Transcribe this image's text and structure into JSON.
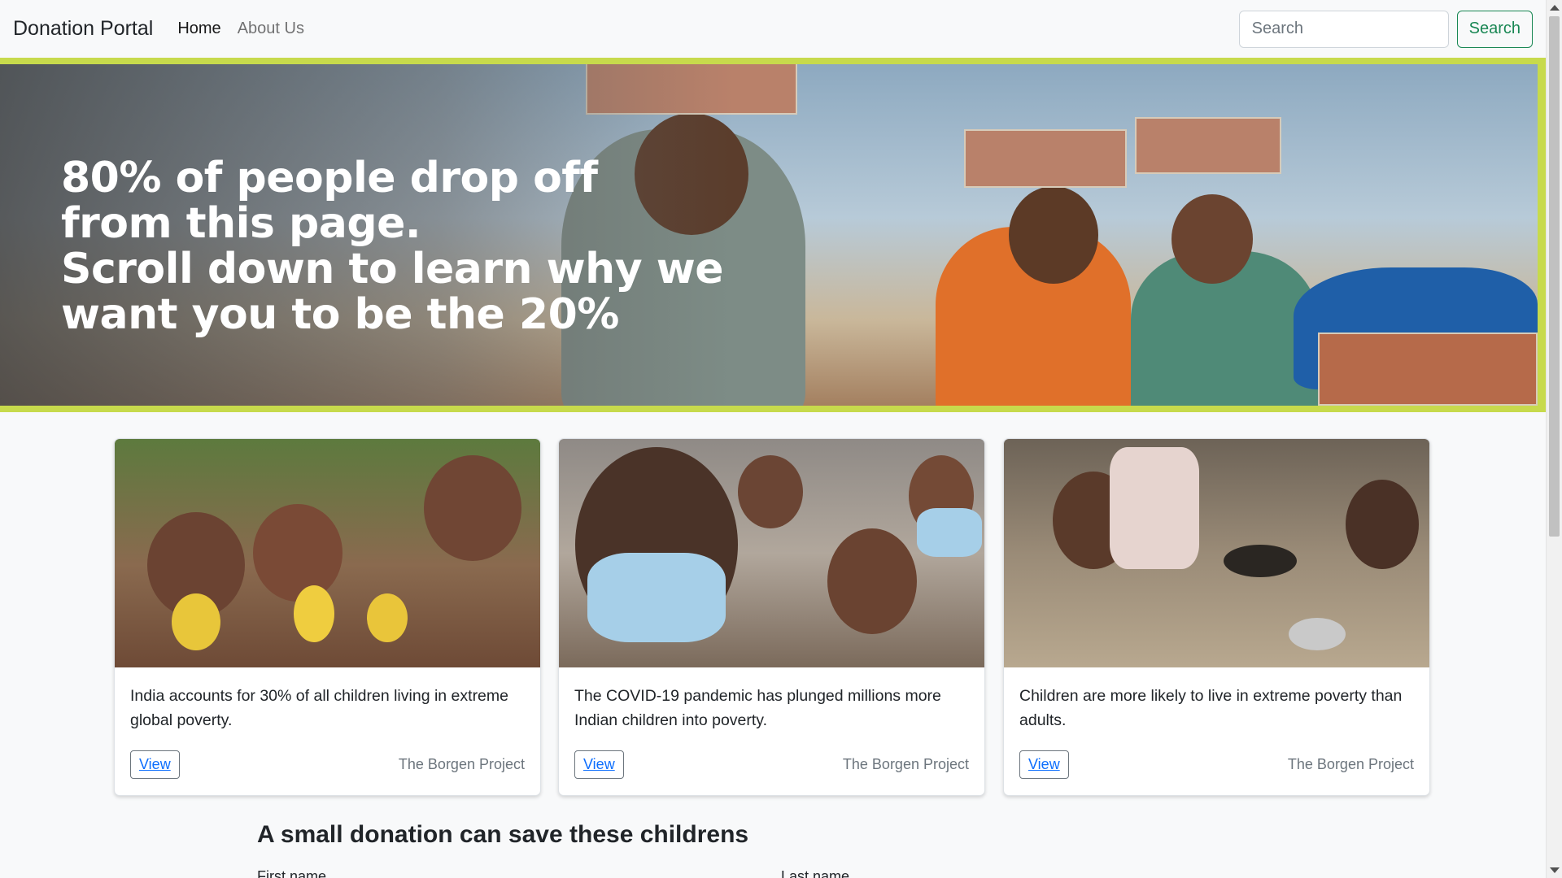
{
  "navbar": {
    "brand": "Donation Portal",
    "links": [
      "Home",
      "About Us"
    ],
    "search_placeholder": "Search",
    "search_button": "Search"
  },
  "hero": {
    "lines": [
      "80% of people drop off",
      "from this page.",
      "Scroll down to learn why we",
      "want you to be the 20%"
    ]
  },
  "cards": [
    {
      "text": "India accounts for 30% of all children living in extreme global poverty.",
      "button": "View",
      "source": "The Borgen Project"
    },
    {
      "text": "The COVID-19 pandemic has plunged millions more Indian children into poverty.",
      "button": "View",
      "source": "The Borgen Project"
    },
    {
      "text": "Children are more likely to live in extreme poverty than adults.",
      "button": "View",
      "source": "The Borgen Project"
    }
  ],
  "donation": {
    "title": "A small donation can save these childrens",
    "first_name_label": "First name",
    "last_name_label": "Last name"
  },
  "colors": {
    "hero_border": "#c7da4c",
    "search_button": "#198754",
    "link": "#0d6efd"
  }
}
